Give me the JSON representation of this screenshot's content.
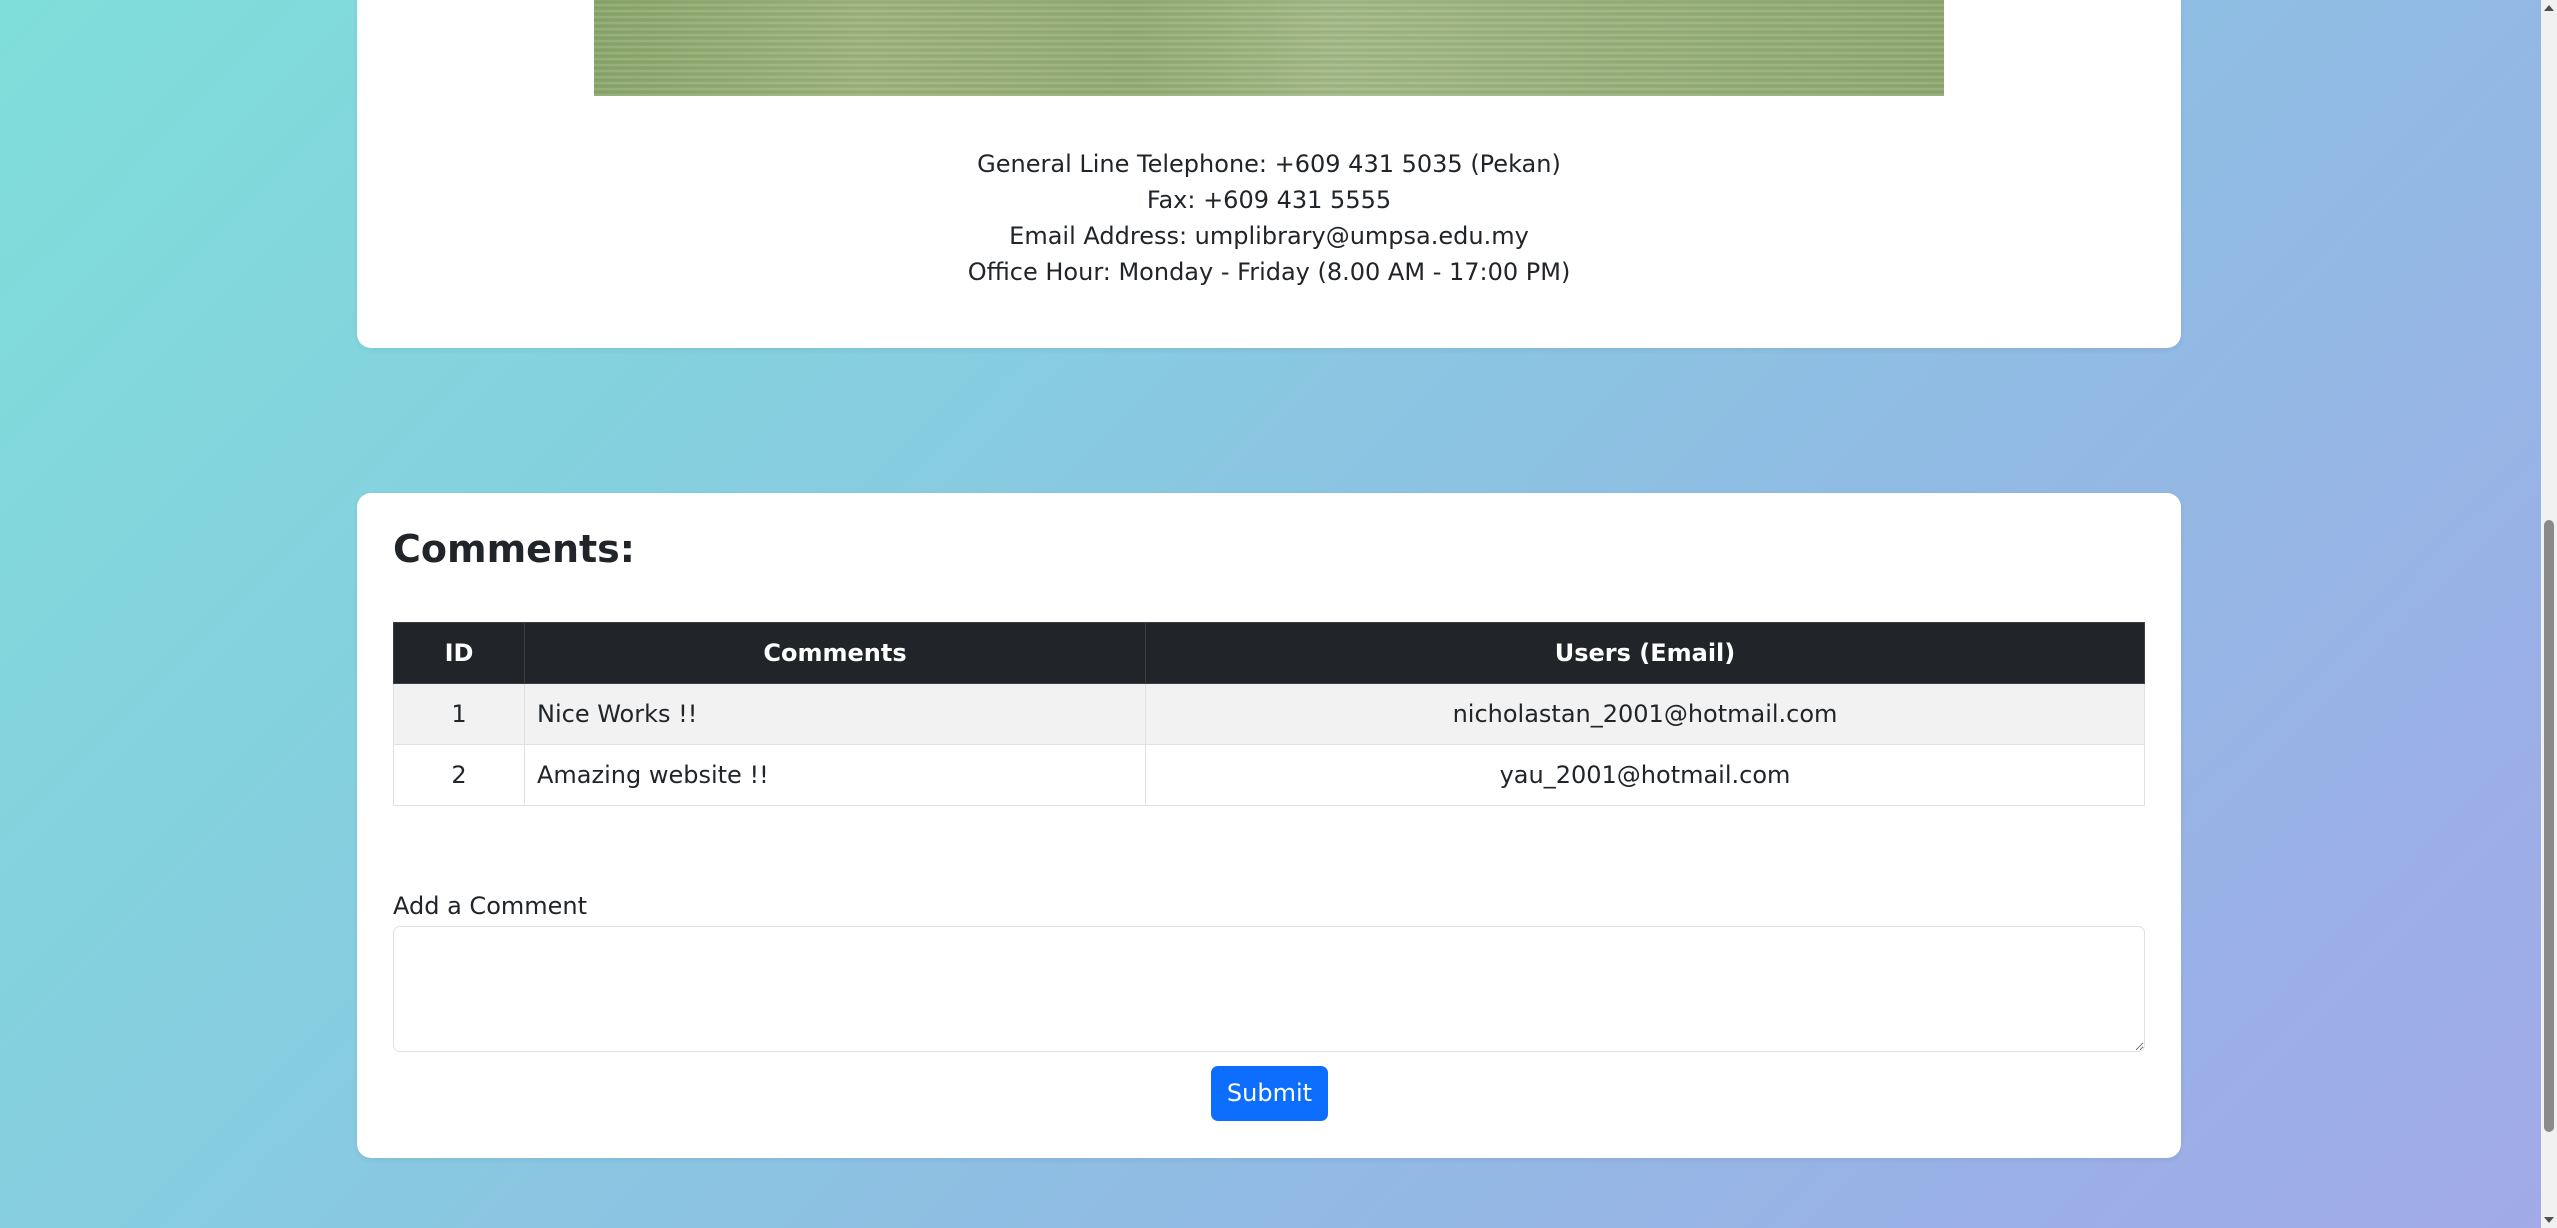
{
  "contact": {
    "telephone": "General Line Telephone: +609 431 5035 (Pekan)",
    "fax": "Fax: +609 431 5555",
    "email": "Email Address: umplibrary@umpsa.edu.my",
    "office_hour": "Office Hour: Monday - Friday (8.00 AM - 17:00 PM)"
  },
  "comments": {
    "title": "Comments:",
    "headers": {
      "id": "ID",
      "comment": "Comments",
      "email": "Users (Email)"
    },
    "rows": [
      {
        "id": "1",
        "comment": "Nice Works !!",
        "email": "nicholastan_2001@hotmail.com"
      },
      {
        "id": "2",
        "comment": "Amazing website !!",
        "email": "yau_2001@hotmail.com"
      }
    ]
  },
  "form": {
    "label": "Add a Comment",
    "value": "",
    "submit_label": "Submit"
  },
  "colors": {
    "accent": "#0d6efd",
    "table_header": "#212529"
  },
  "icons": {
    "scroll_up": "chevron-up-icon",
    "scroll_down": "chevron-down-icon"
  }
}
